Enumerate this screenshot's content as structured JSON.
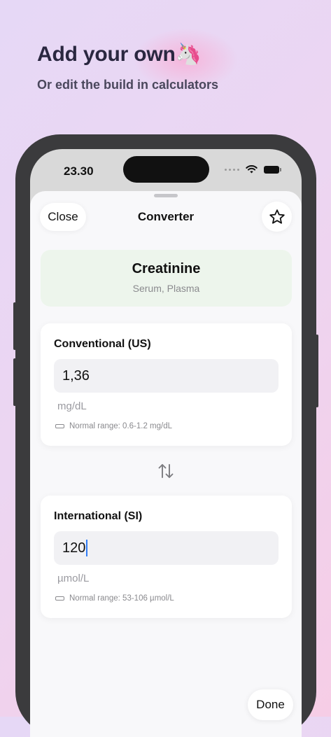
{
  "promo": {
    "headline": "Add your own",
    "headline_emoji": "🦄",
    "subline": "Or edit the build in calculators"
  },
  "status_bar": {
    "time": "23.30",
    "icons": [
      "signal-dots-icon",
      "wifi-icon",
      "battery-icon"
    ]
  },
  "nav": {
    "close_label": "Close",
    "title": "Converter",
    "favorite_icon": "star-icon"
  },
  "analyte": {
    "name": "Creatinine",
    "specimen": "Serum, Plasma"
  },
  "conventional": {
    "label": "Conventional (US)",
    "value": "1,36",
    "unit": "mg/dL",
    "range": "Normal range: 0.6-1.2 mg/dL"
  },
  "international": {
    "label": "International (SI)",
    "value": "120",
    "unit": "µmol/L",
    "range": "Normal range: 53-106 µmol/L"
  },
  "swap_icon": "swap-arrows-icon",
  "done_label": "Done",
  "colors": {
    "header_card_bg": "#edf5ec",
    "caret": "#2f7cf6",
    "phone_frame": "#3b3b3d"
  }
}
